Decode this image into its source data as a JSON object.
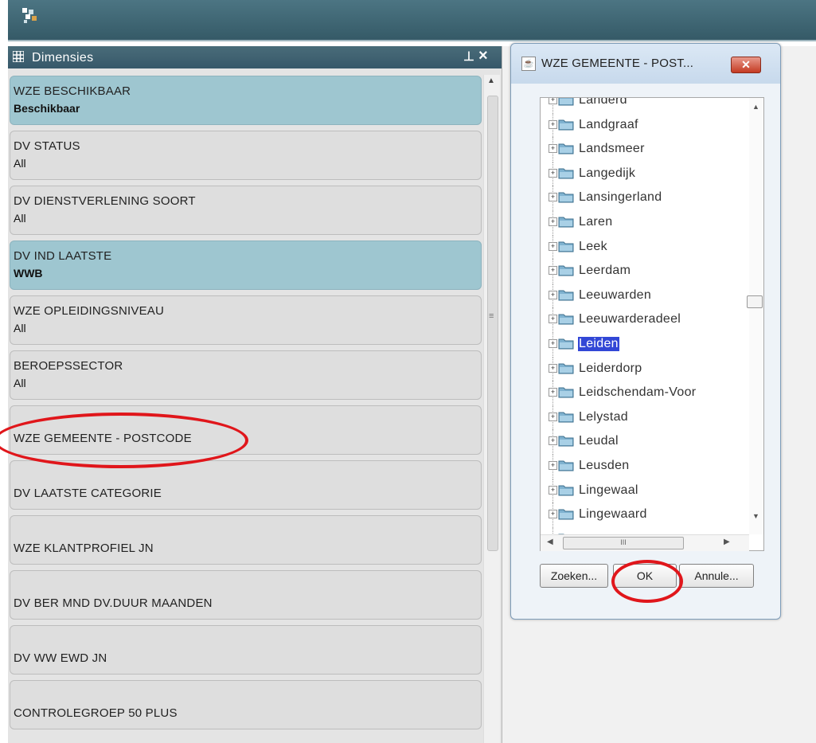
{
  "panel": {
    "title": "Dimensies",
    "pin_glyph": "⊥",
    "close_glyph": "×"
  },
  "dimensions": [
    {
      "name": "WZE BESCHIKBAAR",
      "value": "Beschikbaar",
      "selected": true
    },
    {
      "name": "DV STATUS",
      "value": "All",
      "selected": false
    },
    {
      "name": "DV DIENSTVERLENING SOORT",
      "value": "All",
      "selected": false
    },
    {
      "name": "DV IND LAATSTE",
      "value": "WWB",
      "selected": true
    },
    {
      "name": "WZE OPLEIDINGSNIVEAU",
      "value": "All",
      "selected": false
    },
    {
      "name": "BEROEPSSECTOR",
      "value": "All",
      "selected": false
    },
    {
      "name": "WZE GEMEENTE - POSTCODE",
      "value": "",
      "selected": false
    },
    {
      "name": "DV LAATSTE CATEGORIE",
      "value": "",
      "selected": false
    },
    {
      "name": "WZE KLANTPROFIEL JN",
      "value": "",
      "selected": false
    },
    {
      "name": "DV BER MND DV.DUUR MAANDEN",
      "value": "",
      "selected": false
    },
    {
      "name": "DV WW EWD JN",
      "value": "",
      "selected": false
    },
    {
      "name": "CONTROLEGROEP 50 PLUS",
      "value": "",
      "selected": false
    }
  ],
  "dialog": {
    "title": "WZE GEMEENTE - POST...",
    "close_glyph": "✕",
    "tree_items": [
      {
        "label": "Landerd",
        "selected": false
      },
      {
        "label": "Landgraaf",
        "selected": false
      },
      {
        "label": "Landsmeer",
        "selected": false
      },
      {
        "label": "Langedijk",
        "selected": false
      },
      {
        "label": "Lansingerland",
        "selected": false
      },
      {
        "label": "Laren",
        "selected": false
      },
      {
        "label": "Leek",
        "selected": false
      },
      {
        "label": "Leerdam",
        "selected": false
      },
      {
        "label": "Leeuwarden",
        "selected": false
      },
      {
        "label": "Leeuwarderadeel",
        "selected": false
      },
      {
        "label": "Leiden",
        "selected": true
      },
      {
        "label": "Leiderdorp",
        "selected": false
      },
      {
        "label": "Leidschendam-Voor",
        "selected": false
      },
      {
        "label": "Lelystad",
        "selected": false
      },
      {
        "label": "Leudal",
        "selected": false
      },
      {
        "label": "Leusden",
        "selected": false
      },
      {
        "label": "Lingewaal",
        "selected": false
      },
      {
        "label": "Lingewaard",
        "selected": false
      },
      {
        "label": "",
        "selected": false
      }
    ],
    "hscroll_grip": "III",
    "buttons": {
      "search": "Zoeken...",
      "ok": "OK",
      "cancel": "Annule..."
    }
  },
  "colors": {
    "header_bar": "#3f6574",
    "selected_dimension": "#9ec6d0",
    "tree_selection": "#3247d6",
    "annotation": "#e0161b"
  },
  "icons": {
    "app_logo": "app-logo-icon",
    "panel": "grid-icon",
    "pin": "pin-icon",
    "java": "java-cup-icon",
    "folder": "folder-icon",
    "expander": "plus-expander-icon"
  }
}
